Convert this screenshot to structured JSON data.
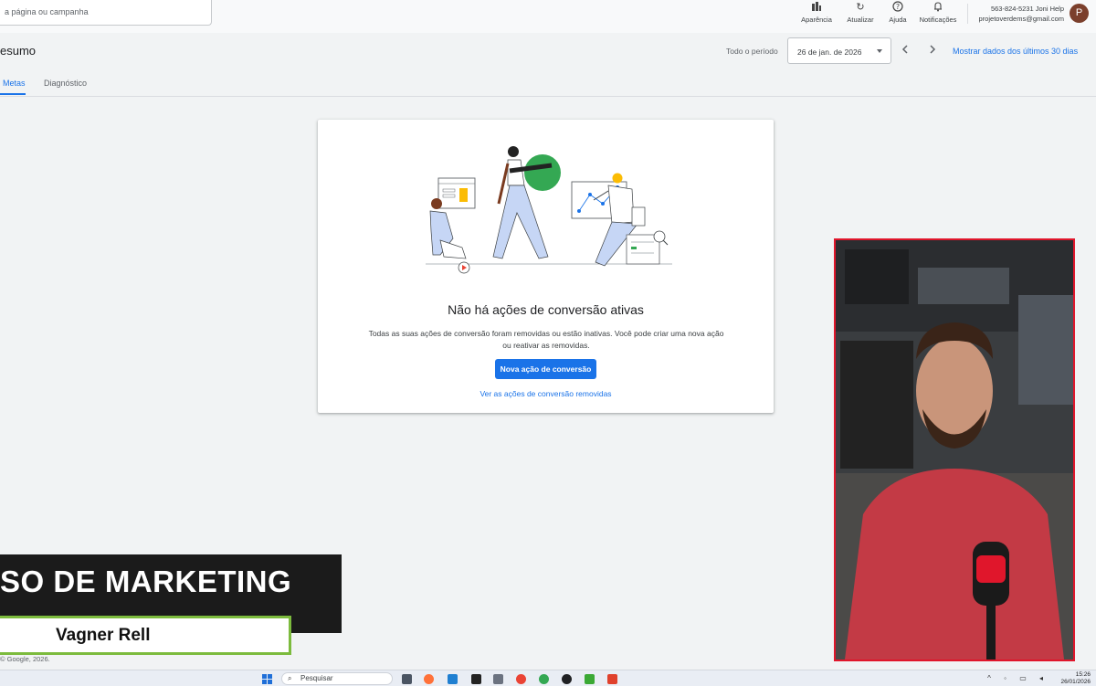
{
  "topbar": {
    "search_placeholder": "a página ou campanha",
    "tools": [
      {
        "label": "Aparência",
        "icon": "appearance-icon"
      },
      {
        "label": "Atualizar",
        "icon": "refresh-icon"
      },
      {
        "label": "Ajuda",
        "icon": "help-icon"
      },
      {
        "label": "Notificações",
        "icon": "bell-icon"
      }
    ],
    "account_line1": "563-824-5231 Joni Help",
    "account_line2": "projetoverdems@gmail.com",
    "avatar_letter": "P"
  },
  "header": {
    "title": "esumo",
    "period_label": "Todo o período",
    "date_value": "26 de jan. de 2026",
    "show_data_link": "Mostrar dados dos últimos 30 dias"
  },
  "tabs": [
    {
      "label": "Metas",
      "active": true
    },
    {
      "label": "Diagnóstico",
      "active": false
    }
  ],
  "card": {
    "title": "Não há ações de conversão ativas",
    "description": "Todas as suas ações de conversão foram removidas ou estão inativas. Você pode criar uma nova ação ou reativar as removidas.",
    "primary_button": "Nova ação de conversão",
    "link": "Ver as ações de conversão removidas"
  },
  "overlay": {
    "banner_title": "SO DE MARKETING",
    "presenter_name": "Vagner Rell",
    "border_color": "#7cbb3d",
    "webcam_border_color": "#e0162b"
  },
  "footer": {
    "copyright": "© Google, 2026."
  },
  "taskbar": {
    "search_label": "Pesquisar",
    "time": "15:26",
    "date": "26/01/2026"
  },
  "colors": {
    "accent": "#1a73e8",
    "background": "#f1f3f4"
  }
}
